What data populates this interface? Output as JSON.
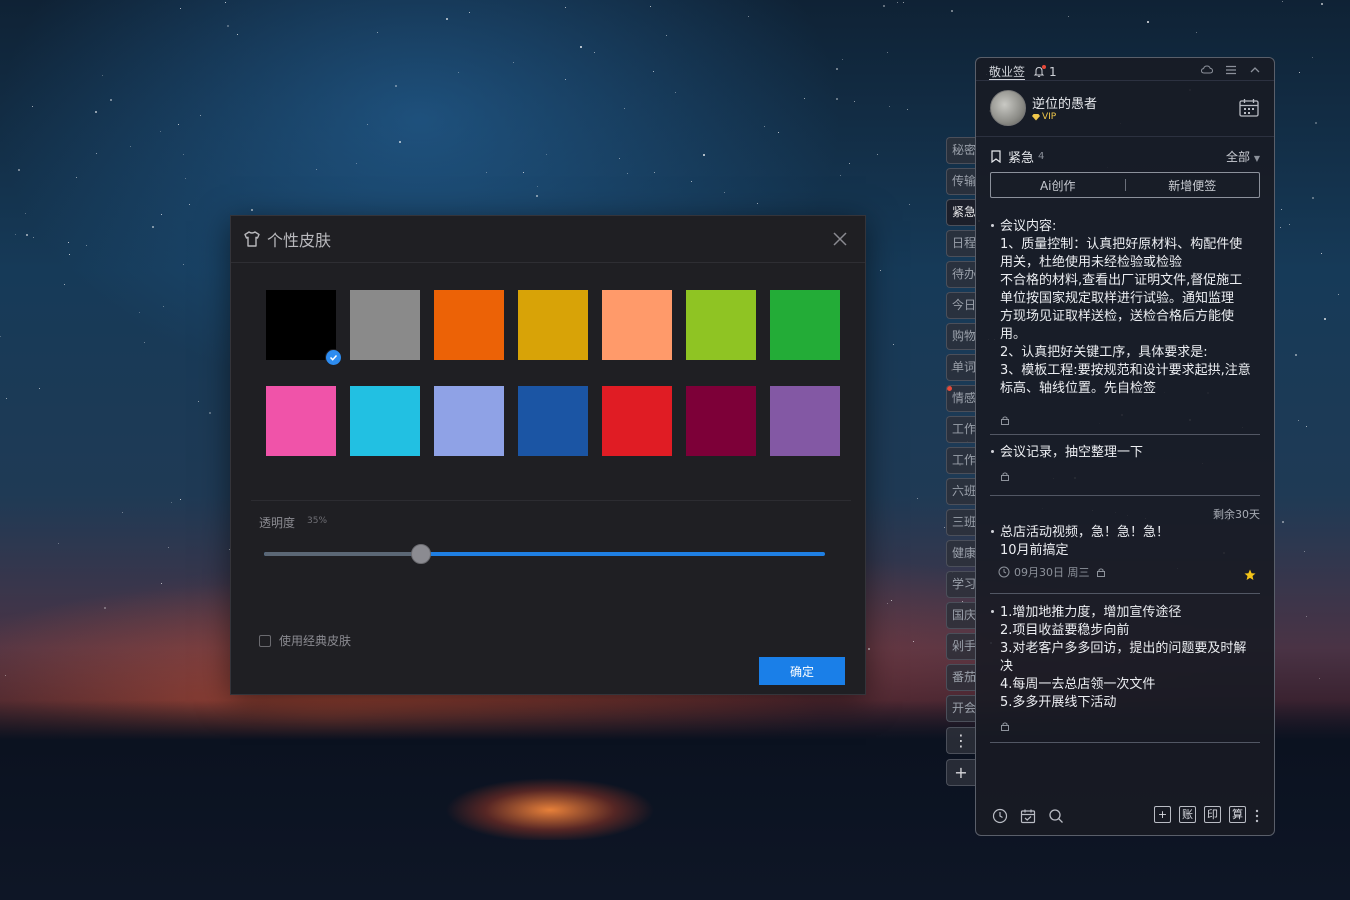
{
  "dialog": {
    "title": "个性皮肤",
    "swatches_row1": [
      "#000000",
      "#8a8a8a",
      "#ec6206",
      "#d8a307",
      "#ff9a6a",
      "#8fc423",
      "#23ac37"
    ],
    "swatches_row2": [
      "#f053a9",
      "#22c0e2",
      "#8fa2e6",
      "#1b55a4",
      "#e01c24",
      "#7d0038",
      "#8358a4"
    ],
    "selected_swatch": "#000000",
    "opacity_label": "透明度",
    "opacity_value": "35%",
    "opacity_fraction": 0.28,
    "classic_skin_label": "使用经典皮肤",
    "classic_skin_checked": false,
    "confirm_label": "确定"
  },
  "tabs": {
    "items": [
      "秘密",
      "传输",
      "紧急",
      "日程",
      "待办",
      "今日",
      "购物",
      "单词",
      "情感",
      "工作",
      "工作",
      "六班",
      "三班",
      "健康",
      "学习",
      "国庆",
      "剁手",
      "番茄",
      "开会"
    ],
    "active": "紧急",
    "more_icon": "⋮",
    "add_icon": "+"
  },
  "panel": {
    "app_name": "敬业签",
    "notification_count": "1",
    "username": "逆位的愚者",
    "vip_label": "VIP",
    "category": "紧急",
    "category_count": "4",
    "filter_label": "全部",
    "ai_button": "Ai创作",
    "new_note_button": "新增便签",
    "notes": [
      {
        "lines": [
          "会议内容:",
          "1、质量控制：认真把好原材料、构配件使",
          "用关，杜绝使用未经检验或检验",
          "不合格的材料,查看出厂证明文件,督促施工",
          "单位按国家规定取样进行试验。通知监理",
          "方现场见证取样送检，送检合格后方能使",
          "用。",
          "2、认真把好关键工序，具体要求是:",
          "3、模板工程:要按规范和设计要求起拱,注意",
          "标高、轴线位置。先自检签"
        ]
      },
      {
        "lines": [
          "会议记录，抽空整理一下"
        ]
      },
      {
        "remaining": "剩余30天",
        "lines": [
          "总店活动视频，急！急！急！",
          "10月前搞定"
        ],
        "date": "09月30日 周三"
      },
      {
        "lines": [
          "1.增加地推力度，增加宣传途径",
          "2.项目收益要稳步向前",
          "3.对老客户多多回访，提出的问题要及时解",
          "决",
          "4.每周一去总店领一次文件",
          "5.多多开展线下活动"
        ]
      }
    ],
    "bottom_boxes": [
      "+",
      "账",
      "印",
      "算"
    ]
  }
}
